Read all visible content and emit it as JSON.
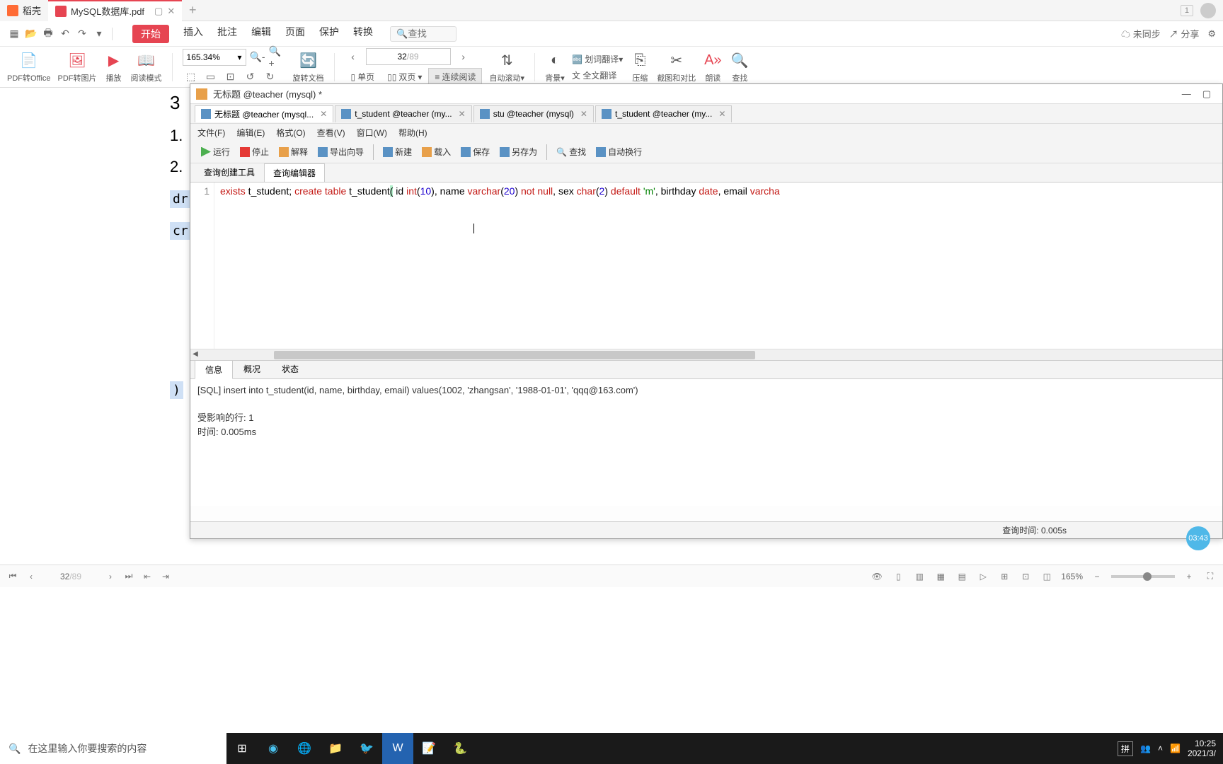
{
  "wps": {
    "tab_home": "稻壳",
    "tab_active": "MySQL数据库.pdf",
    "add": "+",
    "badge": "1",
    "quick": {
      "undo": "↶",
      "redo": "↷"
    },
    "menu": {
      "start": "开始",
      "insert": "插入",
      "annotate": "批注",
      "edit": "编辑",
      "page": "页面",
      "protect": "保护",
      "convert": "转换"
    },
    "search_ph": "查找",
    "cloud": {
      "unsync": "未同步",
      "share": "分享"
    },
    "ribbon": {
      "to_office": "PDF转Office",
      "to_img": "PDF转图片",
      "play": "播放",
      "read_mode": "阅读模式",
      "zoom": "165.34%",
      "rotate": "旋转文档",
      "single": "单页",
      "double": "双页",
      "continuous": "连续阅读",
      "page_current": "32",
      "page_total": "/89",
      "autoscroll": "自动滚动",
      "bg": "背景",
      "word_trans": "划词翻译",
      "full_trans": "全文翻译",
      "compress": "压缩",
      "shot": "截图和对比",
      "read_aloud": "朗读",
      "find": "查找"
    },
    "status": {
      "page_cur": "32",
      "page_total": "/89",
      "zoom": "165%"
    }
  },
  "pdf_bg": {
    "s3": "3",
    "l1": "1.",
    "l2": "2.",
    "h1": "dr",
    "h2": "cr",
    "h3": ")"
  },
  "navicat": {
    "title": "无标题 @teacher (mysql) *",
    "win": {
      "min": "—",
      "max": "▢"
    },
    "tabs": [
      {
        "label": "无标题 @teacher (mysql...",
        "active": true
      },
      {
        "label": "t_student @teacher (my...",
        "active": false
      },
      {
        "label": "stu @teacher (mysql)",
        "active": false
      },
      {
        "label": "t_student @teacher (my...",
        "active": false
      }
    ],
    "menu": {
      "file": "文件(F)",
      "edit": "编辑(E)",
      "format": "格式(O)",
      "view": "查看(V)",
      "window": "窗口(W)",
      "help": "帮助(H)"
    },
    "tool": {
      "run": "运行",
      "stop": "停止",
      "explain": "解释",
      "export": "导出向导",
      "new": "新建",
      "load": "载入",
      "save": "保存",
      "saveas": "另存为",
      "find": "查找",
      "wrap": "自动换行"
    },
    "subtabs": {
      "builder": "查询创建工具",
      "editor": "查询编辑器"
    },
    "editor": {
      "ln": "1",
      "code_tokens": [
        {
          "t": "exists",
          "c": "kw"
        },
        {
          "t": " t_student; "
        },
        {
          "t": "create",
          "c": "kw"
        },
        {
          "t": " "
        },
        {
          "t": "table",
          "c": "kw"
        },
        {
          "t": " t_student"
        },
        {
          "t": "(",
          "c": "hl-paren"
        },
        {
          "t": " id "
        },
        {
          "t": "int",
          "c": "ty"
        },
        {
          "t": "("
        },
        {
          "t": "10",
          "c": "nm"
        },
        {
          "t": "), name "
        },
        {
          "t": "varchar",
          "c": "ty"
        },
        {
          "t": "("
        },
        {
          "t": "20",
          "c": "nm"
        },
        {
          "t": ") "
        },
        {
          "t": "not",
          "c": "kw"
        },
        {
          "t": " "
        },
        {
          "t": "null",
          "c": "kw"
        },
        {
          "t": ", sex "
        },
        {
          "t": "char",
          "c": "ty"
        },
        {
          "t": "("
        },
        {
          "t": "2",
          "c": "nm"
        },
        {
          "t": ") "
        },
        {
          "t": "default",
          "c": "kw"
        },
        {
          "t": " "
        },
        {
          "t": "'m'",
          "c": "st"
        },
        {
          "t": ", birthday "
        },
        {
          "t": "date",
          "c": "ty"
        },
        {
          "t": ", email "
        },
        {
          "t": "varcha",
          "c": "ty"
        }
      ]
    },
    "result_tabs": {
      "info": "信息",
      "overview": "概况",
      "status": "状态"
    },
    "result": {
      "sql": "[SQL] insert into t_student(id, name, birthday, email) values(1002, 'zhangsan', '1988-01-01', 'qqq@163.com')",
      "rows": "受影响的行: 1",
      "time": "时间: 0.005ms"
    },
    "status": "查询时间: 0.005s"
  },
  "timer": "03:43",
  "taskbar": {
    "search_ph": "在这里输入你要搜索的内容",
    "ime": "拼",
    "time": "10:25",
    "date": "2021/3/"
  }
}
